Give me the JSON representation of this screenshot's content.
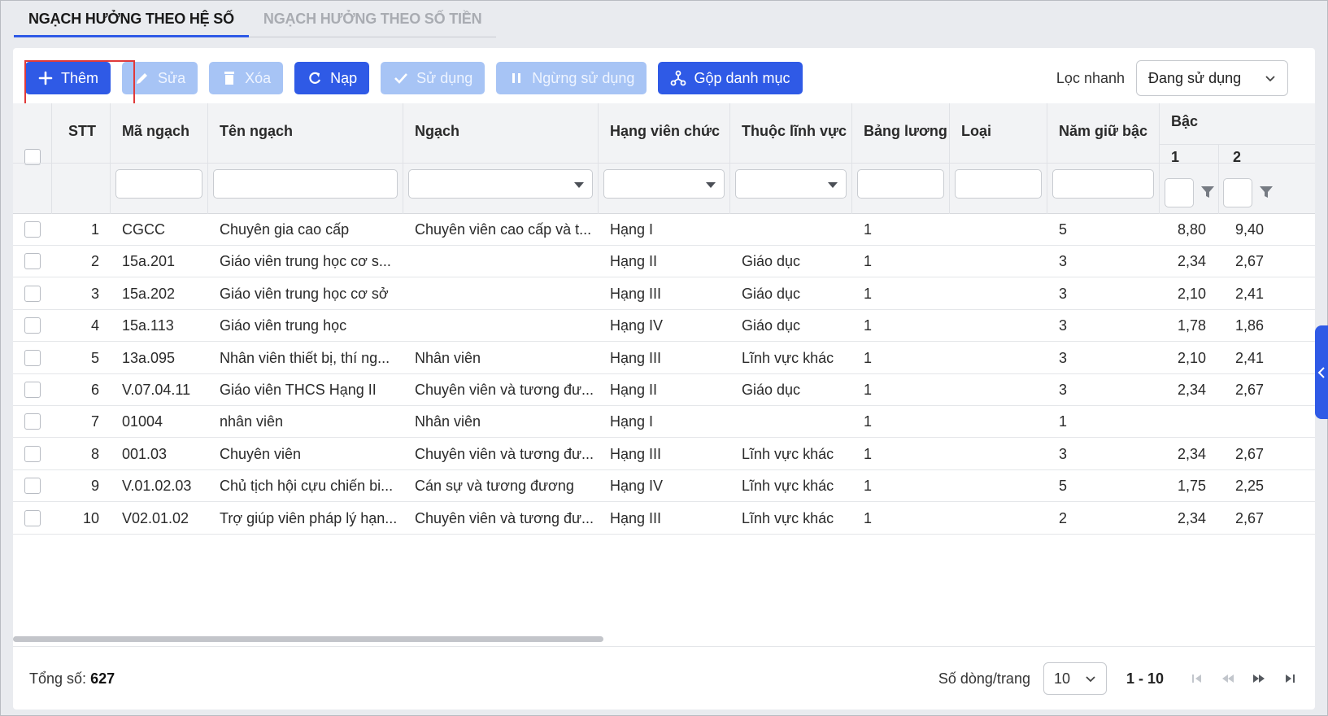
{
  "tabs": [
    {
      "label": "NGẠCH HƯỞNG THEO HỆ SỐ",
      "active": true
    },
    {
      "label": "NGẠCH HƯỞNG THEO SỐ TIỀN",
      "active": false
    }
  ],
  "toolbar": {
    "add_label": "Thêm",
    "edit_label": "Sửa",
    "delete_label": "Xóa",
    "reload_label": "Nạp",
    "use_label": "Sử dụng",
    "stop_label": "Ngừng sử dụng",
    "merge_label": "Gộp danh mục",
    "quick_filter_label": "Lọc nhanh",
    "quick_filter_value": "Đang sử dụng"
  },
  "columns": {
    "stt": "STT",
    "ma_ngach": "Mã ngạch",
    "ten_ngach": "Tên ngạch",
    "ngach": "Ngạch",
    "hang": "Hạng viên chức",
    "linh_vuc": "Thuộc lĩnh vực",
    "bang_luong": "Bảng lương",
    "loai": "Loại",
    "nam_giu_bac": "Năm giữ bậc",
    "bac": "Bậc",
    "bac_1": "1",
    "bac_2": "2"
  },
  "rows": [
    {
      "stt": "1",
      "ma": "CGCC",
      "ten": "Chuyên gia cao cấp",
      "ngach": "Chuyên viên cao cấp và t...",
      "hang": "Hạng I",
      "linh_vuc": "",
      "bang_luong": "1",
      "loai": "",
      "nam": "5",
      "b1": "8,80",
      "b2": "9,40"
    },
    {
      "stt": "2",
      "ma": "15a.201",
      "ten": "Giáo viên trung học cơ s...",
      "ngach": "",
      "hang": "Hạng II",
      "linh_vuc": "Giáo dục",
      "bang_luong": "1",
      "loai": "",
      "nam": "3",
      "b1": "2,34",
      "b2": "2,67"
    },
    {
      "stt": "3",
      "ma": "15a.202",
      "ten": "Giáo viên trung học cơ sở",
      "ngach": "",
      "hang": "Hạng III",
      "linh_vuc": "Giáo dục",
      "bang_luong": "1",
      "loai": "",
      "nam": "3",
      "b1": "2,10",
      "b2": "2,41"
    },
    {
      "stt": "4",
      "ma": "15a.113",
      "ten": "Giáo viên trung học",
      "ngach": "",
      "hang": "Hạng IV",
      "linh_vuc": "Giáo dục",
      "bang_luong": "1",
      "loai": "",
      "nam": "3",
      "b1": "1,78",
      "b2": "1,86"
    },
    {
      "stt": "5",
      "ma": "13a.095",
      "ten": "Nhân viên thiết bị, thí ng...",
      "ngach": "Nhân viên",
      "hang": "Hạng III",
      "linh_vuc": "Lĩnh vực khác",
      "bang_luong": "1",
      "loai": "",
      "nam": "3",
      "b1": "2,10",
      "b2": "2,41"
    },
    {
      "stt": "6",
      "ma": "V.07.04.11",
      "ten": "Giáo viên THCS Hạng II",
      "ngach": "Chuyên viên và tương đư...",
      "hang": "Hạng II",
      "linh_vuc": "Giáo dục",
      "bang_luong": "1",
      "loai": "",
      "nam": "3",
      "b1": "2,34",
      "b2": "2,67"
    },
    {
      "stt": "7",
      "ma": "01004",
      "ten": "nhân viên",
      "ngach": "Nhân viên",
      "hang": "Hạng I",
      "linh_vuc": "",
      "bang_luong": "1",
      "loai": "",
      "nam": "1",
      "b1": "",
      "b2": ""
    },
    {
      "stt": "8",
      "ma": "001.03",
      "ten": "Chuyên viên",
      "ngach": "Chuyên viên và tương đư...",
      "hang": "Hạng III",
      "linh_vuc": "Lĩnh vực khác",
      "bang_luong": "1",
      "loai": "",
      "nam": "3",
      "b1": "2,34",
      "b2": "2,67"
    },
    {
      "stt": "9",
      "ma": "V.01.02.03",
      "ten": "Chủ tịch hội cựu chiến bi...",
      "ngach": "Cán sự và tương đương",
      "hang": "Hạng IV",
      "linh_vuc": "Lĩnh vực khác",
      "bang_luong": "1",
      "loai": "",
      "nam": "5",
      "b1": "1,75",
      "b2": "2,25"
    },
    {
      "stt": "10",
      "ma": "V02.01.02",
      "ten": "Trợ giúp viên pháp lý hạn...",
      "ngach": "Chuyên viên và tương đư...",
      "hang": "Hạng III",
      "linh_vuc": "Lĩnh vực khác",
      "bang_luong": "1",
      "loai": "",
      "nam": "2",
      "b1": "2,34",
      "b2": "2,67"
    }
  ],
  "footer": {
    "total_label": "Tổng số:",
    "total_value": "627",
    "rows_per_page_label": "Số dòng/trang",
    "rows_per_page": "10",
    "range": "1 - 10"
  }
}
